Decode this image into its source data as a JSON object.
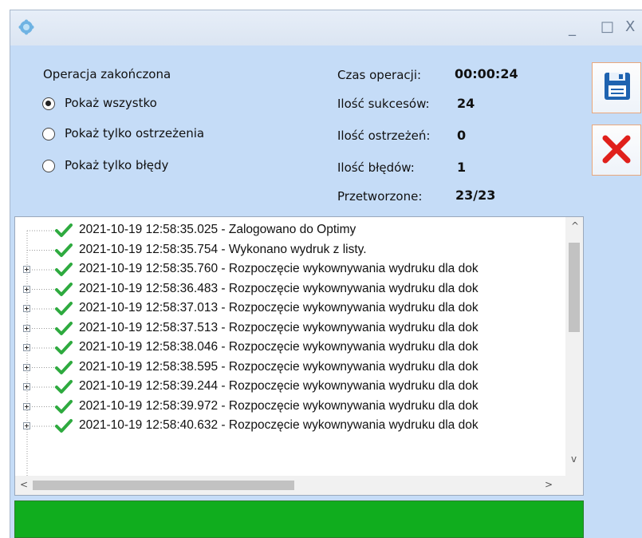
{
  "window": {
    "minimize_glyph": "_",
    "maximize_glyph": "□",
    "close_glyph": "X",
    "app_icon": "gear-icon"
  },
  "options": {
    "heading": "Operacja zakończona",
    "radios": [
      {
        "label": "Pokaż wszystko",
        "checked": true
      },
      {
        "label": "Pokaż tylko ostrzeżenia",
        "checked": false
      },
      {
        "label": "Pokaż tylko błędy",
        "checked": false
      }
    ]
  },
  "stats": [
    {
      "label": "Czas operacji:",
      "value": "00:00:24"
    },
    {
      "label": "Ilość sukcesów:",
      "value": "24"
    },
    {
      "label": "Ilość ostrzeżeń:",
      "value": "0"
    },
    {
      "label": "Ilość błędów:",
      "value": "1"
    },
    {
      "label": "Przetworzone:",
      "value": "23/23"
    }
  ],
  "buttons": {
    "save": {
      "icon": "floppy-disk-icon"
    },
    "close": {
      "icon": "red-x-icon"
    }
  },
  "log": {
    "entries": [
      {
        "text": "2021-10-19 12:58:35.025 - Zalogowano do Optimy",
        "expandable": false
      },
      {
        "text": "2021-10-19 12:58:35.754 - Wykonano wydruk z listy.",
        "expandable": false
      },
      {
        "text": "2021-10-19 12:58:35.760 - Rozpoczęcie wykownywania wydruku dla dok",
        "expandable": true
      },
      {
        "text": "2021-10-19 12:58:36.483 - Rozpoczęcie wykownywania wydruku dla dok",
        "expandable": true
      },
      {
        "text": "2021-10-19 12:58:37.013 - Rozpoczęcie wykownywania wydruku dla dok",
        "expandable": true
      },
      {
        "text": "2021-10-19 12:58:37.513 - Rozpoczęcie wykownywania wydruku dla dok",
        "expandable": true
      },
      {
        "text": "2021-10-19 12:58:38.046 - Rozpoczęcie wykownywania wydruku dla dok",
        "expandable": true
      },
      {
        "text": "2021-10-19 12:58:38.595 - Rozpoczęcie wykownywania wydruku dla dok",
        "expandable": true
      },
      {
        "text": "2021-10-19 12:58:39.244 - Rozpoczęcie wykownywania wydruku dla dok",
        "expandable": true
      },
      {
        "text": "2021-10-19 12:58:39.972 - Rozpoczęcie wykownywania wydruku dla dok",
        "expandable": true
      },
      {
        "text": "2021-10-19 12:58:40.632 - Rozpoczęcie wykownywania wydruku dla dok",
        "expandable": true
      }
    ],
    "scroll_up": "^",
    "scroll_down": "v",
    "scroll_left": "<",
    "scroll_right": ">"
  },
  "status": {
    "color": "#10ad1e"
  }
}
